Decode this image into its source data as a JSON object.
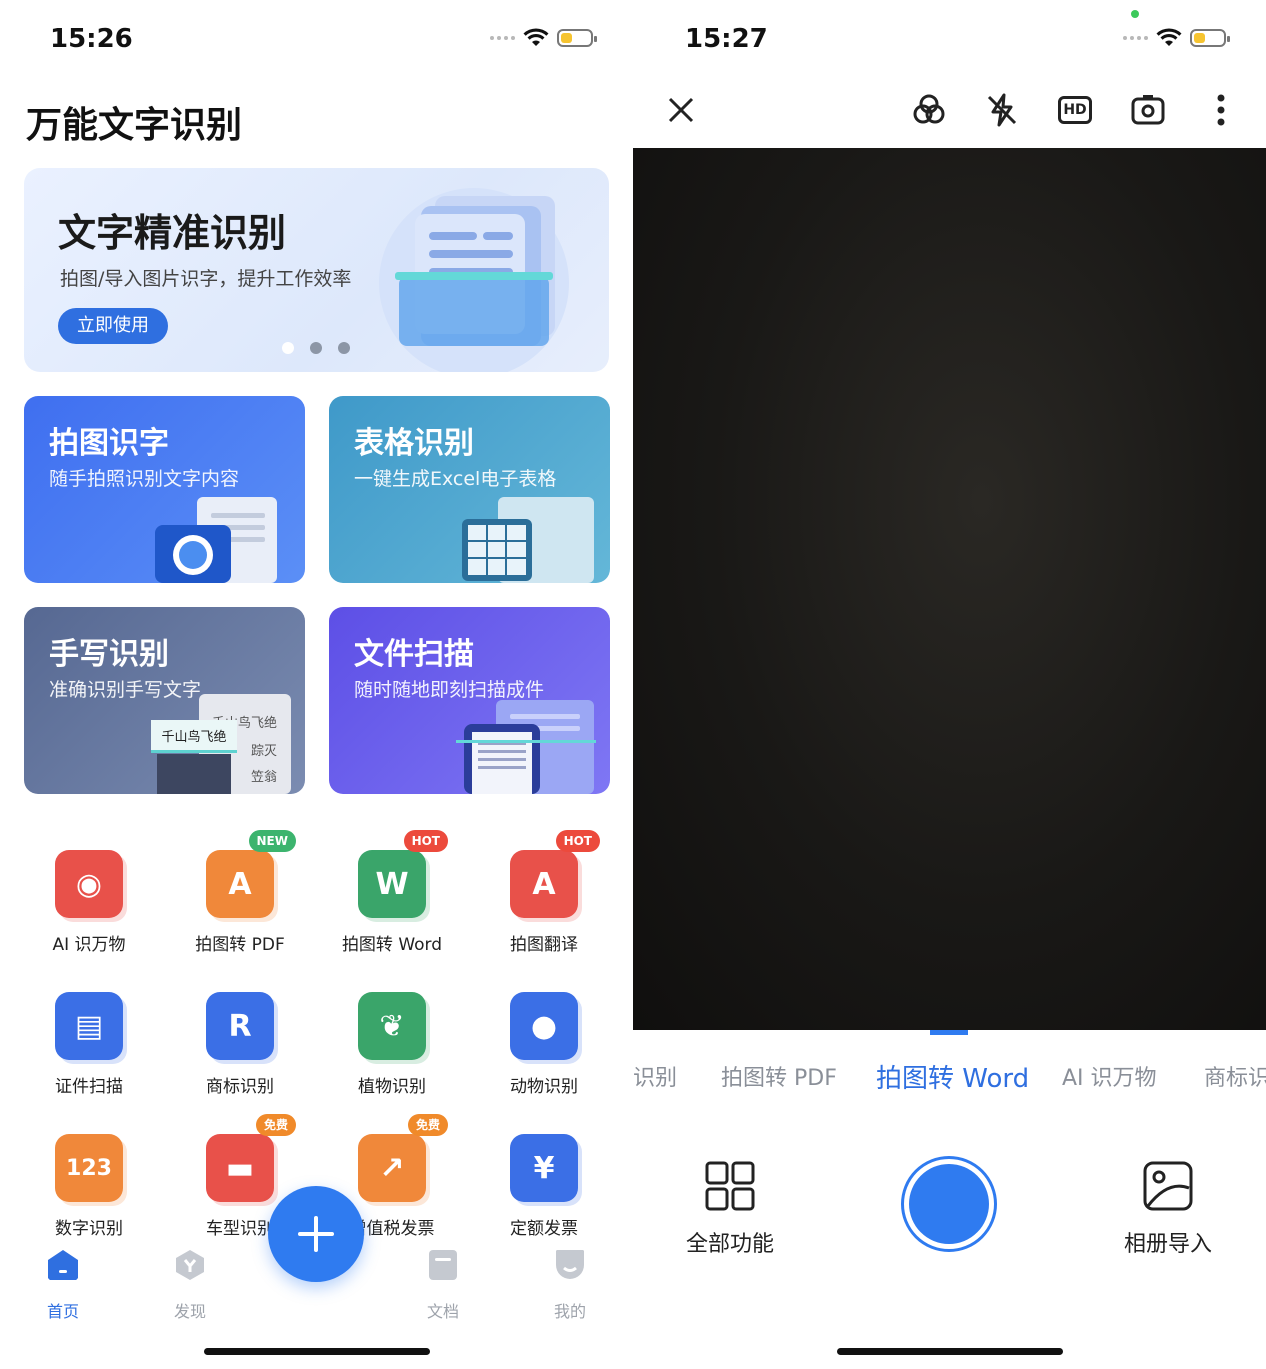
{
  "left_screen": {
    "status": {
      "time": "15:26"
    },
    "app_title": "万能文字识别",
    "banner": {
      "title": "文字精准识别",
      "subtitle": "拍图/导入图片识字，提升工作效率",
      "button": "立即使用",
      "pages": 3,
      "current_page": 1
    },
    "feature_cards": [
      {
        "title": "拍图识字",
        "subtitle": "随手拍照识别文字内容",
        "color": "#4a77ee"
      },
      {
        "title": "表格识别",
        "subtitle": "一键生成Excel电子表格",
        "color": "#4aa0cc"
      },
      {
        "title": "手写识别",
        "subtitle": "准确识别手写文字",
        "color": "#60709a"
      },
      {
        "title": "文件扫描",
        "subtitle": "随时随地即刻扫描成件",
        "color": "#6a5ff0"
      }
    ],
    "handwriting_sample": {
      "line1": "千山鸟飞绝",
      "line2": "千山鸟飞绝",
      "line3": "踪灭",
      "line4": "笠翁"
    },
    "tools": [
      {
        "label": "AI 识万物",
        "icon": "eye-scan-icon",
        "color": "#e8514a",
        "tag": ""
      },
      {
        "label": "拍图转 PDF",
        "icon": "pdf-icon",
        "color": "#f0883a",
        "tag": "NEW"
      },
      {
        "label": "拍图转 Word",
        "icon": "word-icon",
        "color": "#3aa56a",
        "tag": "HOT"
      },
      {
        "label": "拍图翻译",
        "icon": "translate-icon",
        "color": "#e8514a",
        "tag": "HOT"
      },
      {
        "label": "证件扫描",
        "icon": "id-card-icon",
        "color": "#3b6fe6",
        "tag": ""
      },
      {
        "label": "商标识别",
        "icon": "trademark-icon",
        "color": "#3b6fe6",
        "tag": ""
      },
      {
        "label": "植物识别",
        "icon": "plant-icon",
        "color": "#3aa56a",
        "tag": ""
      },
      {
        "label": "动物识别",
        "icon": "panda-icon",
        "color": "#3b6fe6",
        "tag": ""
      },
      {
        "label": "数字识别",
        "icon": "number-icon",
        "color": "#f0883a",
        "tag": ""
      },
      {
        "label": "车型识别",
        "icon": "car-icon",
        "color": "#e8514a",
        "tag": "免费"
      },
      {
        "label": "增值税发票",
        "icon": "vat-invoice-icon",
        "color": "#f0883a",
        "tag": "免费"
      },
      {
        "label": "定额发票",
        "icon": "fixed-invoice-icon",
        "color": "#3b6fe6",
        "tag": ""
      }
    ],
    "tag_colors": {
      "NEW": "#3cb46e",
      "HOT": "#ec4a3c",
      "免费": "#f08a2a"
    },
    "bottom_nav": [
      {
        "label": "首页",
        "active": true
      },
      {
        "label": "发现",
        "active": false
      },
      {
        "label": "文档",
        "active": false
      },
      {
        "label": "我的",
        "active": false
      }
    ],
    "fab_symbol": "+"
  },
  "right_screen": {
    "status": {
      "time": "15:27"
    },
    "toolbar": [
      "close-icon",
      "filter-icon",
      "flash-off-icon",
      "hd-icon",
      "switch-camera-icon",
      "more-icon"
    ],
    "hd_label": "HD",
    "modes": [
      "识别",
      "拍图转 PDF",
      "拍图转 Word",
      "AI 识万物",
      "商标识"
    ],
    "active_mode": "拍图转 Word",
    "all_features": "全部功能",
    "album_import": "相册导入"
  }
}
